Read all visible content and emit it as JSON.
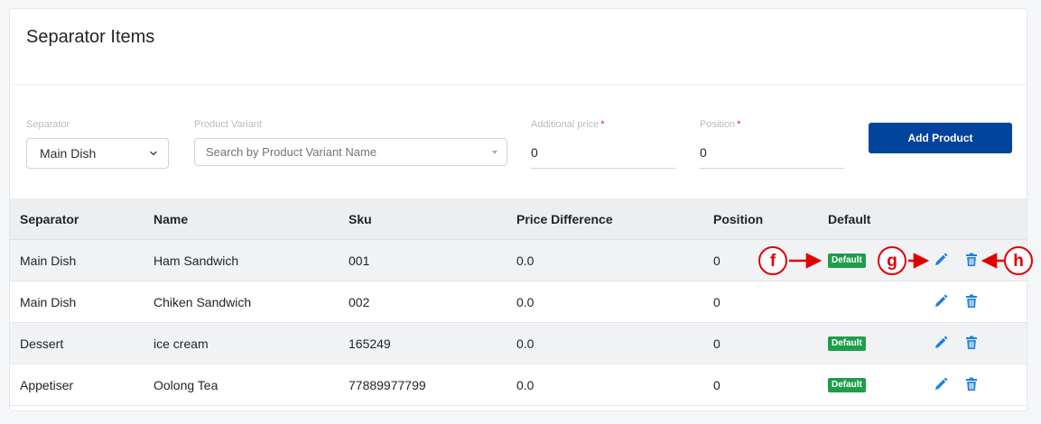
{
  "card": {
    "title": "Separator Items"
  },
  "form": {
    "separator": {
      "label": "Separator",
      "value": "Main Dish"
    },
    "variant": {
      "label": "Product Variant",
      "placeholder": "Search by Product Variant Name"
    },
    "additional_price": {
      "label": "Additional price",
      "required_mark": "*",
      "value": "0"
    },
    "position": {
      "label": "Position",
      "required_mark": "*",
      "value": "0"
    },
    "add_button": "Add Product"
  },
  "table": {
    "headers": [
      "Separator",
      "Name",
      "Sku",
      "Price Difference",
      "Position",
      "Default"
    ],
    "rows": [
      {
        "separator": "Main Dish",
        "name": "Ham Sandwich",
        "sku": "001",
        "price_difference": "0.0",
        "position": "0",
        "default": "Default"
      },
      {
        "separator": "Main Dish",
        "name": "Chiken Sandwich",
        "sku": "002",
        "price_difference": "0.0",
        "position": "0",
        "default": ""
      },
      {
        "separator": "Dessert",
        "name": "ice cream",
        "sku": "165249",
        "price_difference": "0.0",
        "position": "0",
        "default": "Default"
      },
      {
        "separator": "Appetiser",
        "name": "Oolong Tea",
        "sku": "77889977799",
        "price_difference": "0.0",
        "position": "0",
        "default": "Default"
      }
    ]
  },
  "annotations": {
    "f": "f",
    "g": "g",
    "h": "h"
  },
  "colors": {
    "primary": "#00449e",
    "badge": "#1e9d4a",
    "action_icon": "#1a7fe8",
    "annotation": "#e00000"
  },
  "icons": {
    "edit": "pencil-icon",
    "delete": "trash-icon",
    "dropdown": "chevron-down-icon"
  }
}
